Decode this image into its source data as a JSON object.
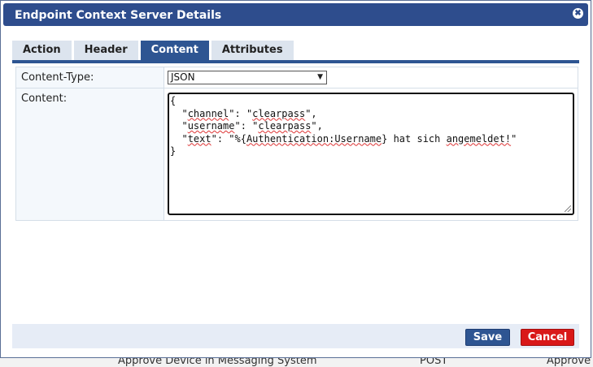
{
  "dialog": {
    "title": "Endpoint Context Server Details",
    "close_glyph": "✖"
  },
  "tabs": [
    {
      "label": "Action",
      "active": false
    },
    {
      "label": "Header",
      "active": false
    },
    {
      "label": "Content",
      "active": true
    },
    {
      "label": "Attributes",
      "active": false
    }
  ],
  "form": {
    "content_type_label": "Content-Type:",
    "content_type_value": "JSON",
    "content_label": "Content:",
    "content_lines": [
      "{",
      "  \"channel\": \"clearpass\",",
      "  \"username\": \"clearpass\",",
      "  \"text\": \"%{Authentication:Username} hat sich angemeldet!\"",
      "}"
    ]
  },
  "footer": {
    "save_label": "Save",
    "cancel_label": "Cancel"
  },
  "background": {
    "bottom_left_text": "Approve Device in Messaging System",
    "bottom_mid_text": "POST",
    "bottom_right_text": "Approve the"
  },
  "colors": {
    "titlebar": "#2e4d8d",
    "tab_active": "#2e5592",
    "cancel": "#d91818"
  },
  "icons": {
    "close": "close-icon",
    "dropdown": "chevron-down-icon",
    "resize": "resize-grip-icon"
  }
}
